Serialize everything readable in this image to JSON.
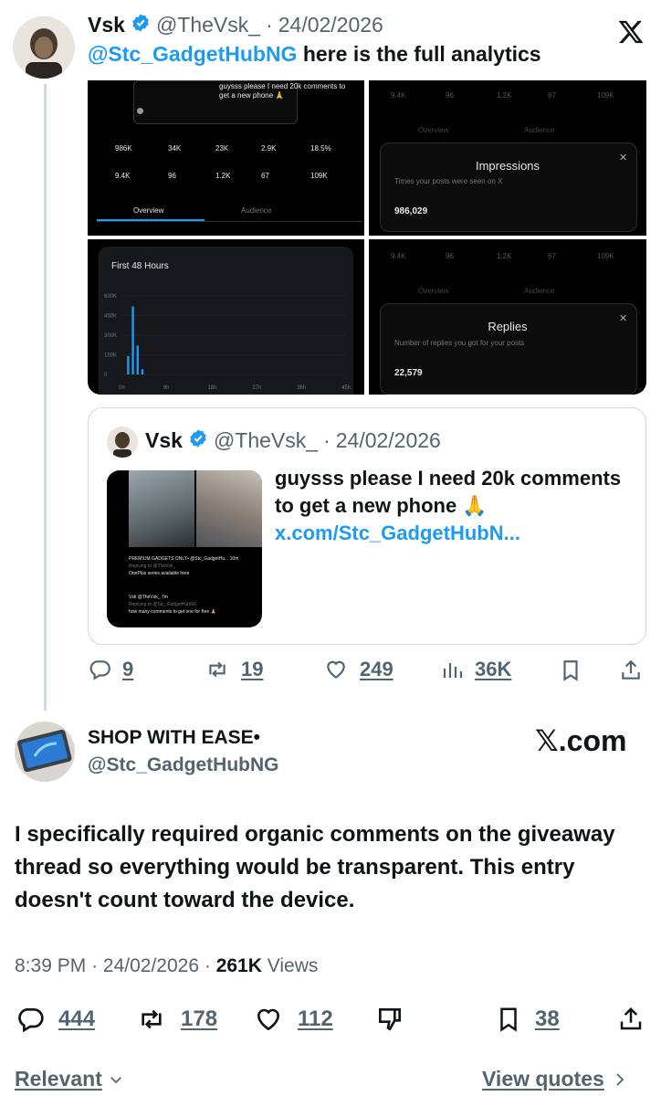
{
  "original": {
    "name": "Vsk",
    "handle": "@TheVsk_",
    "sep": "·",
    "date": "24/02/2026",
    "mention": "@Stc_GadgetHubNG",
    "text": " here is the full analytics",
    "brand_icon": "x-logo-icon"
  },
  "media": {
    "top_left": {
      "tweet_snippet": "guysss please I need 20k comments to get a new phone 🙏",
      "stats_row1": [
        "986K",
        "34K",
        "23K",
        "2.9K",
        "18.5%"
      ],
      "stats_row2": [
        "9.4K",
        "96",
        "1.2K",
        "67",
        "109K"
      ],
      "tab_overview": "Overview",
      "tab_audience": "Audience"
    },
    "bottom_left": {
      "chart_title": "First 48 Hours",
      "chart_data": {
        "type": "bar",
        "title": "First 48 Hours",
        "y_ticks": [
          "600K",
          "450K",
          "300K",
          "150K",
          "0"
        ],
        "x_ticks": [
          "0h",
          "9h",
          "18h",
          "27h",
          "36h",
          "45h"
        ],
        "ylim": [
          0,
          600000
        ],
        "x": [
          1,
          2,
          3,
          4
        ],
        "values": [
          140000,
          520000,
          220000,
          40000
        ]
      }
    },
    "top_right": {
      "stats": [
        "9.4K",
        "96",
        "1.2K",
        "67",
        "109K"
      ],
      "tab_overview": "Overview",
      "tab_audience": "Audience",
      "card_title": "Impressions",
      "card_desc": "Times your posts were seen on X",
      "card_value": "986,029"
    },
    "bottom_right": {
      "stats": [
        "9.4K",
        "96",
        "1.2K",
        "67",
        "109K"
      ],
      "tab_overview": "Overview",
      "tab_audience": "Audience",
      "card_title": "Replies",
      "card_desc": "Number of replies you got for your posts",
      "card_value": "22,579"
    }
  },
  "quoted": {
    "name": "Vsk",
    "handle": "@TheVsk_",
    "sep": "·",
    "date": "24/02/2026",
    "text": "guysss please I need 20k comments to get a new phone 🙏",
    "link": "x.com/Stc_GadgetHubN...",
    "thumb": {
      "line1": "PREMIUM GADGETS ONLY• @Stc_GadgetHu... 10m",
      "line2": "Replying to @TheVsk_",
      "line3": "OnePlus series available here",
      "line4": "Vsk @TheVsk_ 7m",
      "line5": "Replying to @Stc_GadgetHubNG",
      "line6": "how many comments to get one for free 🙏"
    }
  },
  "original_actions": {
    "replies": "9",
    "reposts": "19",
    "likes": "249",
    "views": "36K"
  },
  "reply": {
    "name": "SHOP WITH EASE•",
    "handle": "@Stc_GadgetHubNG",
    "brand": "𝕏.com",
    "text": "I specifically required organic comments on the giveaway thread so everything would be transparent. This entry doesn't count toward the device.",
    "time": "8:39 PM",
    "sep1": "·",
    "date": "24/02/2026",
    "sep2": "·",
    "views_count": "261K",
    "views_label": "Views"
  },
  "reply_actions": {
    "replies": "444",
    "reposts": "178",
    "likes": "112",
    "bookmarks": "38"
  },
  "footer": {
    "relevant": "Relevant",
    "view_quotes": "View quotes"
  },
  "colors": {
    "accent": "#1d9bf0",
    "text": "#0f1419",
    "muted": "#536471",
    "border": "#cfd9de"
  }
}
